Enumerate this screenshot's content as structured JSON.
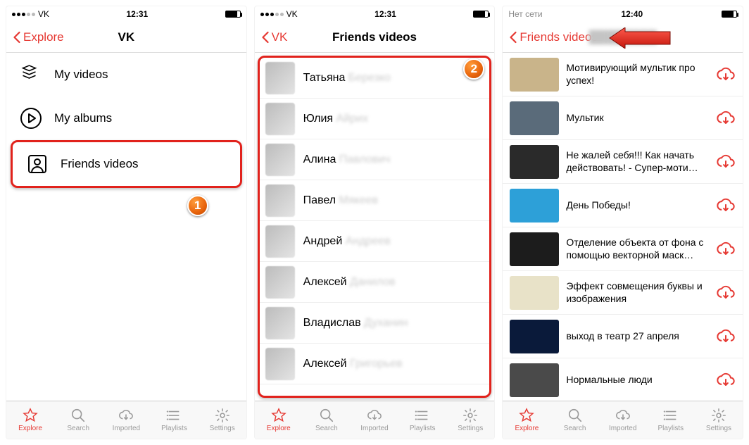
{
  "screen1": {
    "status": {
      "carrier": "VK",
      "time": "12:31"
    },
    "back": "Explore",
    "title": "VK",
    "menu": [
      {
        "label": "My videos"
      },
      {
        "label": "My albums"
      },
      {
        "label": "Friends videos"
      }
    ],
    "badge": "1"
  },
  "screen2": {
    "status": {
      "carrier": "VK",
      "time": "12:31"
    },
    "back": "VK",
    "title": "Friends videos",
    "friends": [
      {
        "first": "Татьяна",
        "rest": "Березко"
      },
      {
        "first": "Юлия",
        "rest": "Айрих"
      },
      {
        "first": "Алина",
        "rest": "Павлович"
      },
      {
        "first": "Павел",
        "rest": "Мякеев"
      },
      {
        "first": "Андрей",
        "rest": "Андреев"
      },
      {
        "first": "Алексей",
        "rest": "Данилов"
      },
      {
        "first": "Владислав",
        "rest": "Духанин"
      },
      {
        "first": "Алексей",
        "rest": "Григорьев"
      }
    ],
    "badge": "2"
  },
  "screen3": {
    "status": {
      "carrier": "Нет сети",
      "time": "12:40"
    },
    "back": "Friends videos",
    "videos": [
      {
        "title": "Мотивирующий мультик про успех!",
        "thumb": "#c9b48a"
      },
      {
        "title": "Мультик",
        "thumb": "#5a6b7a"
      },
      {
        "title": "Не жалей себя!!! Как начать действовать! - Супер-моти…",
        "thumb": "#2a2a2a"
      },
      {
        "title": "День Победы!",
        "thumb": "#2da0d8"
      },
      {
        "title": "Отделение объекта от фона с помощью векторной маск…",
        "thumb": "#1c1c1c"
      },
      {
        "title": "Эффект совмещения буквы и изображения",
        "thumb": "#e8e2c8"
      },
      {
        "title": "выход в театр 27 апреля",
        "thumb": "#0a1a3a"
      },
      {
        "title": "Нормальные люди",
        "thumb": "#4a4a4a"
      }
    ]
  },
  "tabs": [
    {
      "label": "Explore",
      "active": true
    },
    {
      "label": "Search"
    },
    {
      "label": "Imported"
    },
    {
      "label": "Playlists"
    },
    {
      "label": "Settings"
    }
  ]
}
